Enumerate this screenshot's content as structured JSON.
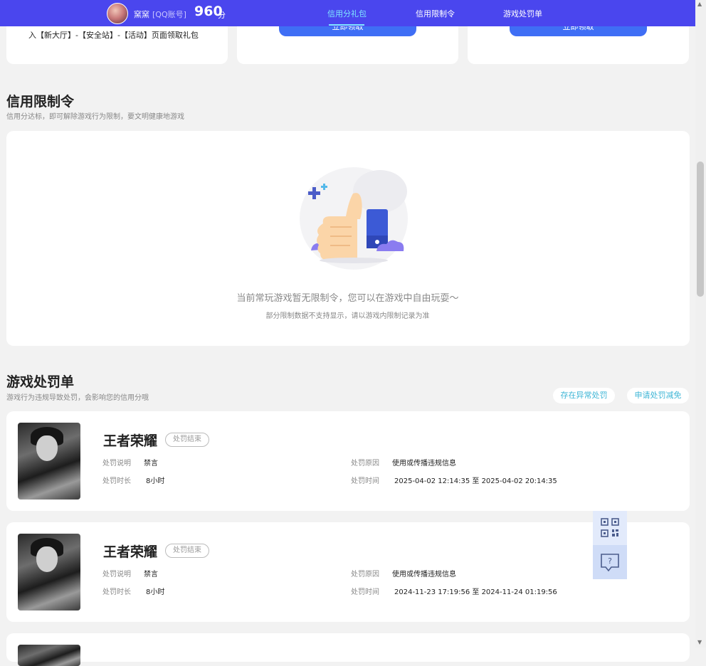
{
  "header": {
    "username": "窯窯",
    "account": "[QQ账号]",
    "score": "960",
    "score_unit": "分",
    "nav": [
      "信用分礼包",
      "信用限制令",
      "游戏处罚单"
    ]
  },
  "top_cards": {
    "card1_text": "入【新大厅】-【安全站】-【活动】页面领取礼包",
    "claim_label": "立即领取"
  },
  "restriction": {
    "title": "信用限制令",
    "subtitle": "信用分达标，即可解除游戏行为限制，要文明健康地游戏",
    "empty_main": "当前常玩游戏暂无限制令，您可以在游戏中自由玩耍～",
    "empty_sub": "部分限制数据不支持显示，请以游戏内限制记录为准"
  },
  "penalty": {
    "title": "游戏处罚单",
    "subtitle": "游戏行为违规导致处罚，会影响您的信用分哦",
    "btn_doubt": "存在异常处罚",
    "btn_appeal": "申请处罚减免",
    "labels": {
      "desc": "处罚说明",
      "duration": "处罚时长",
      "reason": "处罚原因",
      "time": "处罚时间"
    },
    "items": [
      {
        "game": "王者荣耀",
        "status": "处罚结束",
        "desc": "禁言",
        "duration": "8小时",
        "reason": "使用或传播违规信息",
        "time": "2025-04-02 12:14:35 至 2025-04-02 20:14:35"
      },
      {
        "game": "王者荣耀",
        "status": "处罚结束",
        "desc": "禁言",
        "duration": "8小时",
        "reason": "使用或传播违规信息",
        "time": "2024-11-23 17:19:56 至 2024-11-24 01:19:56"
      }
    ]
  },
  "icons": {
    "qr": "qr-code-icon",
    "help": "help-chat-icon"
  },
  "colors": {
    "header_bg": "#4a46ee",
    "nav_active": "#7fe7ff",
    "claim_btn": "#3f6ef5",
    "pill_text": "#3fb6d6"
  }
}
